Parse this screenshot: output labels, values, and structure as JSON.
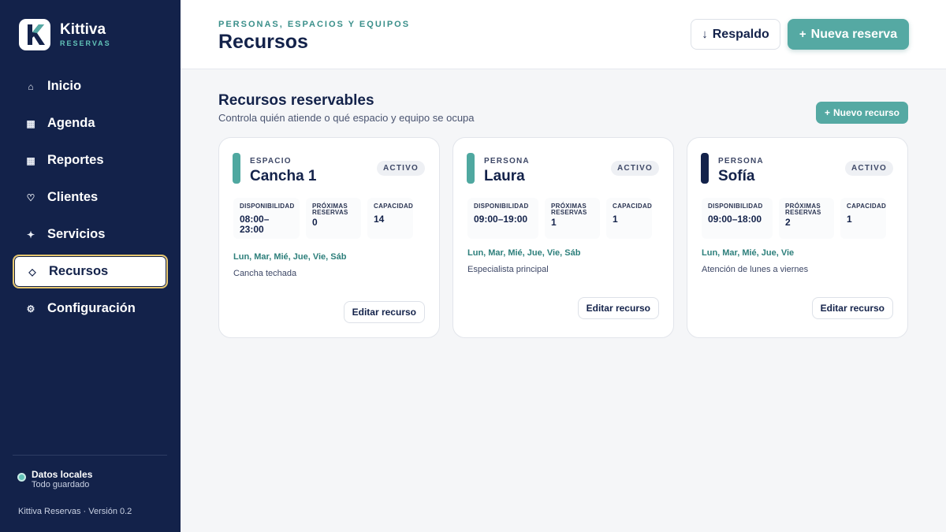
{
  "brand": {
    "name": "Kittiva",
    "subtitle": "RESERVAS",
    "logo_letter": "K"
  },
  "nav": [
    {
      "label": "Inicio",
      "icon": "home-icon",
      "glyph": "⌂",
      "active": false
    },
    {
      "label": "Agenda",
      "icon": "calendar-icon",
      "glyph": "▦",
      "active": false
    },
    {
      "label": "Reportes",
      "icon": "reports-icon",
      "glyph": "▦",
      "active": false
    },
    {
      "label": "Clientes",
      "icon": "heart-icon",
      "glyph": "♡",
      "active": false
    },
    {
      "label": "Servicios",
      "icon": "sparkle-icon",
      "glyph": "✦",
      "active": false
    },
    {
      "label": "Recursos",
      "icon": "diamond-icon",
      "glyph": "◇",
      "active": true
    },
    {
      "label": "Configuración",
      "icon": "gear-icon",
      "glyph": "⚙",
      "active": false
    }
  ],
  "status": {
    "title": "Datos locales",
    "subtitle": "Todo guardado"
  },
  "version": "Kittiva Reservas · Versión 0.2",
  "header": {
    "eyebrow": "PERSONAS, ESPACIOS Y EQUIPOS",
    "title": "Recursos",
    "backup_label": "Respaldo",
    "new_booking_label": "Nueva reserva"
  },
  "section": {
    "title": "Recursos reservables",
    "subtitle": "Controla quién atiende o qué espacio y equipo se ocupa",
    "new_resource_label": "Nuevo recurso"
  },
  "stat_labels": {
    "availability": "DISPONIBILIDAD",
    "upcoming": "PRÓXIMAS RESERVAS",
    "capacity": "CAPACIDAD"
  },
  "cards": [
    {
      "type": "ESPACIO",
      "name": "Cancha 1",
      "badge": "ACTIVO",
      "color": "#4fa8a0",
      "availability": "08:00–23:00",
      "upcoming": "0",
      "capacity": "14",
      "days": "Lun, Mar, Mié, Jue, Vie, Sáb",
      "note": "Cancha techada",
      "edit_label": "Editar recurso"
    },
    {
      "type": "PERSONA",
      "name": "Laura",
      "badge": "ACTIVO",
      "color": "#4fa8a0",
      "availability": "09:00–19:00",
      "upcoming": "1",
      "capacity": "1",
      "days": "Lun, Mar, Mié, Jue, Vie, Sáb",
      "note": "Especialista principal",
      "edit_label": "Editar recurso"
    },
    {
      "type": "PERSONA",
      "name": "Sofía",
      "badge": "ACTIVO",
      "color": "#13224a",
      "availability": "09:00–18:00",
      "upcoming": "2",
      "capacity": "1",
      "days": "Lun, Mar, Mié, Jue, Vie",
      "note": "Atención de lunes a viernes",
      "edit_label": "Editar recurso"
    }
  ]
}
